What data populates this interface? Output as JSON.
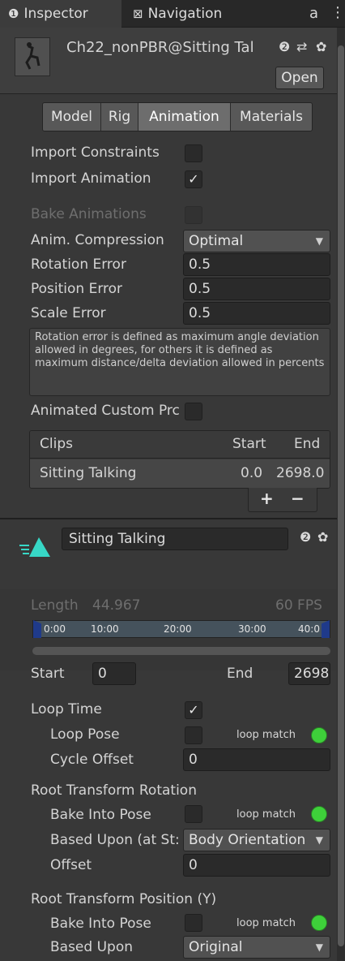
{
  "tabs": {
    "inspector": "Inspector",
    "navigation": "Navigation"
  },
  "header": {
    "title": "Ch22_nonPBR@Sitting Tal",
    "open_label": "Open"
  },
  "toolbar": [
    "Model",
    "Rig",
    "Animation",
    "Materials"
  ],
  "import": {
    "constraints_label": "Import Constraints",
    "animation_label": "Import Animation",
    "bake_label": "Bake Animations",
    "compression_label": "Anim. Compression",
    "compression_value": "Optimal",
    "rotation_error_label": "Rotation Error",
    "rotation_error_value": "0.5",
    "position_error_label": "Position Error",
    "position_error_value": "0.5",
    "scale_error_label": "Scale Error",
    "scale_error_value": "0.5",
    "help_text": "Rotation error is defined as maximum angle deviation allowed in degrees, for others it is defined as maximum distance/delta deviation allowed in percents",
    "custom_props_label": "Animated Custom Prc"
  },
  "clips": {
    "col_clips": "Clips",
    "col_start": "Start",
    "col_end": "End",
    "rows": [
      {
        "name": "Sitting Talking",
        "start": "0.0",
        "end": "2698.0"
      }
    ],
    "plus": "+",
    "minus": "−"
  },
  "clip": {
    "name": "Sitting Talking",
    "length_label": "Length",
    "length_value": "44.967",
    "fps": "60 FPS",
    "ticks": [
      "0:00",
      "10:00",
      "20:00",
      "30:00",
      "40:0"
    ],
    "start_label": "Start",
    "start_value": "0",
    "end_label": "End",
    "end_value": "2698",
    "loop_time": "Loop Time",
    "loop_pose": "Loop Pose",
    "loop_match": "loop match",
    "cycle_offset": "Cycle Offset",
    "cycle_offset_value": "0",
    "root_rotation": "Root Transform Rotation",
    "bake_into_pose": "Bake Into Pose",
    "based_upon_start": "Based Upon (at St:",
    "body_orientation": "Body Orientation",
    "offset": "Offset",
    "offset_value": "0",
    "root_position_y": "Root Transform Position (Y)",
    "based_upon": "Based Upon",
    "original": "Original"
  }
}
